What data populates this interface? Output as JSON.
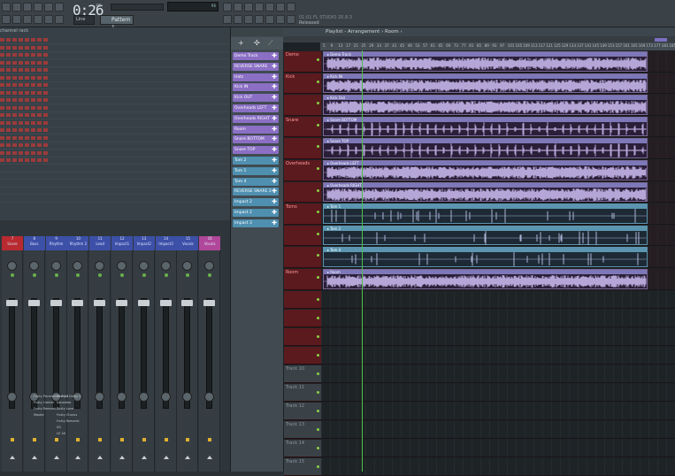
{
  "toolbar": {
    "time": "0:26",
    "time_sub": "49",
    "pattern": "Pattern 1",
    "snap": "Line",
    "cpu_text": "96",
    "news_line1": "01:01  FL STUDIO 20.8.3",
    "news_line2": "Released"
  },
  "rack": {
    "title": "channel rack"
  },
  "mixer": {
    "strips": [
      {
        "num": "7",
        "name": "Snare",
        "color": "red"
      },
      {
        "num": "8",
        "name": "Bass",
        "color": "blue"
      },
      {
        "num": "9",
        "name": "Rhythm",
        "color": "blue"
      },
      {
        "num": "10",
        "name": "Rhythm 2",
        "color": "blue"
      },
      {
        "num": "11",
        "name": "Lead",
        "color": "blue"
      },
      {
        "num": "12",
        "name": "Impact1",
        "color": "blue"
      },
      {
        "num": "13",
        "name": "Impact2",
        "color": "blue"
      },
      {
        "num": "14",
        "name": "Impact3",
        "color": "blue"
      },
      {
        "num": "15",
        "name": "Vocals",
        "color": "blue"
      },
      {
        "num": "16",
        "name": "Vocals",
        "color": "pink"
      }
    ],
    "fx_col1": [
      "Fruity Parametric EQ 2",
      "Fruity Limiter",
      "Fruity Reeverb 2",
      "Master"
    ],
    "fx_col2": [
      "Pitched Delay 2",
      "Saturator",
      "Fruity Love",
      "Fruity Chorus",
      "Fruity Reeverb",
      "SG",
      "LE 18"
    ]
  },
  "picker": {
    "items": [
      {
        "label": "Demo Track",
        "color": "#8a6fc4"
      },
      {
        "label": "REVERSE SNARE",
        "color": "#8a6fc4"
      },
      {
        "label": "Hats",
        "color": "#8a6fc4"
      },
      {
        "label": "Kick IN",
        "color": "#8a6fc4"
      },
      {
        "label": "Kick OUT",
        "color": "#8a6fc4"
      },
      {
        "label": "Overheads LEFT",
        "color": "#8a6fc4"
      },
      {
        "label": "Overheads RIGHT",
        "color": "#8a6fc4"
      },
      {
        "label": "Room",
        "color": "#8a6fc4"
      },
      {
        "label": "Snare BOTTOM",
        "color": "#8a6fc4"
      },
      {
        "label": "Snare TOP",
        "color": "#8a6fc4"
      },
      {
        "label": "Tom 2",
        "color": "#4f8fb0"
      },
      {
        "label": "Tom 1",
        "color": "#4f8fb0"
      },
      {
        "label": "Tom 4",
        "color": "#4f8fb0"
      },
      {
        "label": "REVERSE SNARE 2",
        "color": "#4f8fb0"
      },
      {
        "label": "Impact 2",
        "color": "#4f8fb0"
      },
      {
        "label": "Impact 2",
        "color": "#4f8fb0"
      },
      {
        "label": "Impact 3",
        "color": "#4f8fb0"
      }
    ]
  },
  "playlist": {
    "title": "Playlist - Arrangement › Room ›",
    "ruler": [
      "5",
      "9",
      "13",
      "17",
      "21",
      "25",
      "29",
      "33",
      "37",
      "41",
      "45",
      "49",
      "53",
      "57",
      "61",
      "65",
      "69",
      "73",
      "77",
      "81",
      "85",
      "89",
      "93",
      "97",
      "101",
      "105",
      "109",
      "113",
      "117",
      "121",
      "125",
      "129",
      "133",
      "137",
      "141",
      "145",
      "149",
      "153",
      "157",
      "161",
      "165",
      "169",
      "173",
      "177",
      "181",
      "185"
    ],
    "tracks": [
      {
        "label": "Demo",
        "clip": "Demo Track",
        "type": "dense"
      },
      {
        "label": "Kick",
        "clip": "Kick IN",
        "type": "dense"
      },
      {
        "label": "",
        "clip": "Kick Out",
        "type": "dense"
      },
      {
        "label": "Snare",
        "clip": "Snare BOTTOM",
        "type": "spikes"
      },
      {
        "label": "",
        "clip": "Snare TOP",
        "type": "spikes"
      },
      {
        "label": "Overheads",
        "clip": "Overheads LEFT",
        "type": "dense"
      },
      {
        "label": "",
        "clip": "Overheads RIGHT",
        "type": "dense"
      },
      {
        "label": "Toms",
        "clip": "Tom 1",
        "type": "sparse"
      },
      {
        "label": "",
        "clip": "Tom 2",
        "type": "sparse"
      },
      {
        "label": "",
        "clip": "Tom 4",
        "type": "sparse"
      },
      {
        "label": "Room",
        "clip": "Room",
        "type": "dense"
      }
    ],
    "empty_tracks": [
      "",
      "",
      "",
      "",
      "Track 10",
      "Track 11",
      "Track 12",
      "Track 13",
      "Track 14",
      "Track 15",
      "Track 16"
    ]
  }
}
